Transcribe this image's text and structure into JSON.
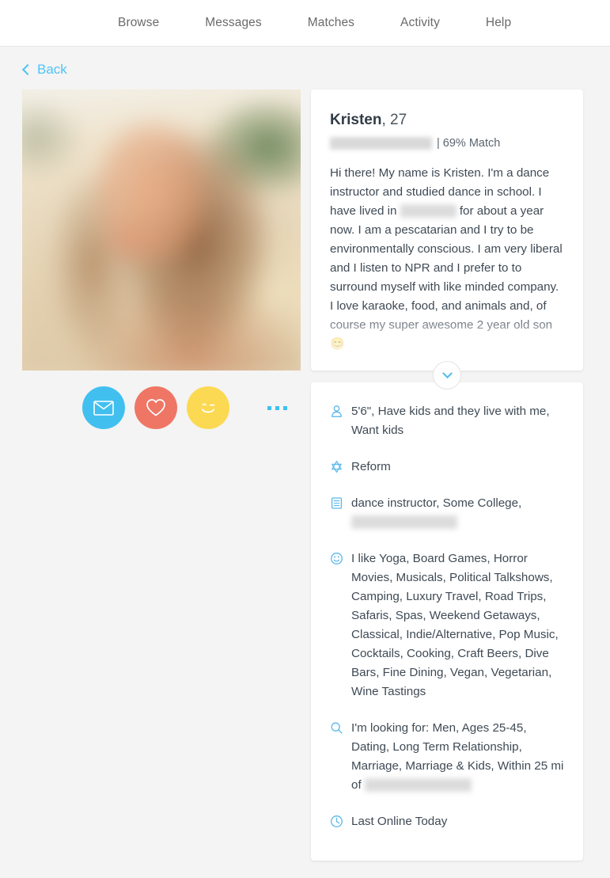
{
  "nav": {
    "items": [
      {
        "label": "Browse"
      },
      {
        "label": "Messages"
      },
      {
        "label": "Matches"
      },
      {
        "label": "Activity"
      },
      {
        "label": "Help"
      }
    ]
  },
  "back": {
    "label": "Back",
    "icon": "chevron-left-icon"
  },
  "profile": {
    "name": "Kristen",
    "age": ", 27",
    "location_redacted": "Henderson, Nevada",
    "match": "| 69% Match",
    "bio_part1": "Hi there! My name is Kristen. I'm a dance instructor and studied dance in school. I have lived in ",
    "bio_location_redacted": "Las Vegas",
    "bio_part2": " for about a year now. I am a pescatarian and I try to be environmentally conscious. I am very liberal and I listen to NPR and I prefer to to surround myself with like minded company. I love karaoke, food, and animals and, of course my super awesome 2 year old son ",
    "bio_emoji": "😊"
  },
  "actions": {
    "message": {
      "icon": "envelope-icon",
      "color": "#41c0f0"
    },
    "like": {
      "icon": "heart-icon",
      "color": "#ef7665"
    },
    "wink": {
      "icon": "wink-smiley-icon",
      "color": "#fcd952"
    },
    "more": {
      "icon": "more-dots-icon",
      "color": "#3dc0f2"
    }
  },
  "expand": {
    "icon": "chevron-down-icon"
  },
  "details": [
    {
      "icon": "person-icon",
      "text": "5'6\", Have kids and they live with me, Want kids",
      "redacted": ""
    },
    {
      "icon": "star-of-david-icon",
      "text": "Reform",
      "redacted": ""
    },
    {
      "icon": "document-icon",
      "text": "dance instructor, Some College, ",
      "redacted": "Greenwood College"
    },
    {
      "icon": "smiley-icon",
      "text": "I like Yoga, Board Games, Horror Movies, Musicals, Political Talkshows, Camping, Luxury Travel, Road Trips, Safaris, Spas, Weekend Getaways, Classical, Indie/Alternative, Pop Music, Cocktails, Cooking, Craft Beers, Dive Bars, Fine Dining, Vegan, Vegetarian, Wine Tastings",
      "redacted": ""
    },
    {
      "icon": "search-icon",
      "text": "I'm looking for: Men, Ages 25-45, Dating, Long Term Relationship, Marriage, Marriage & Kids, Within 25 mi of ",
      "redacted": "Henderson, Nevada"
    },
    {
      "icon": "clock-icon",
      "text": "Last Online Today",
      "redacted": ""
    }
  ]
}
